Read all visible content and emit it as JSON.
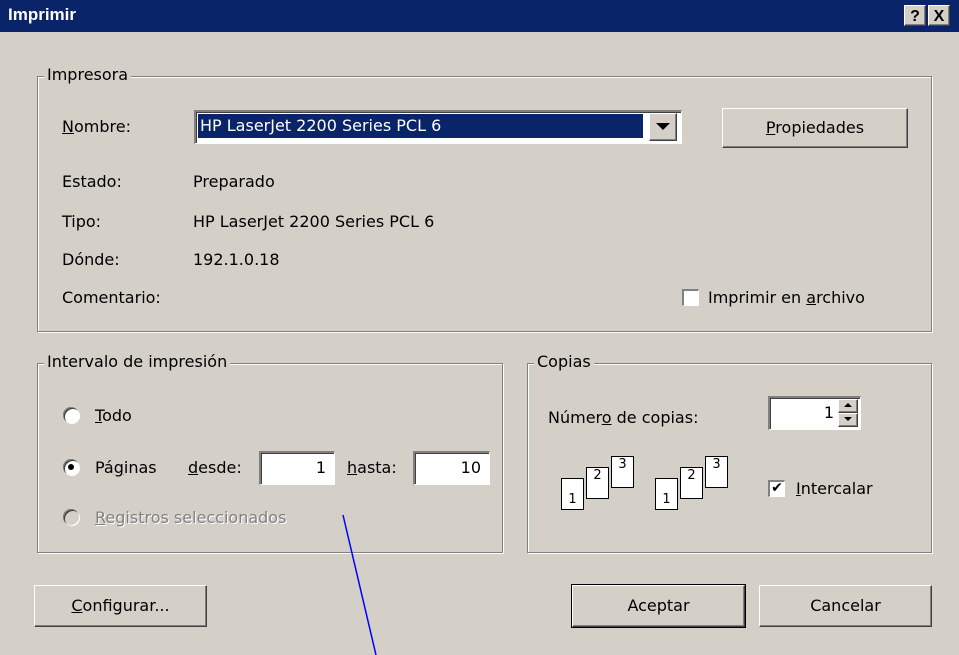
{
  "window": {
    "title": "Imprimir",
    "help_label": "?",
    "close_label": "X"
  },
  "printer_group": {
    "legend": "Impresora",
    "name_label_accel": "N",
    "name_label_rest": "ombre:",
    "name_value": "HP LaserJet 2200 Series PCL 6",
    "dropdown_icon": "chevron-down",
    "properties_accel": "P",
    "properties_rest": "ropiedades",
    "status_label": "Estado:",
    "status_value": "Preparado",
    "type_label": "Tipo:",
    "type_value": "HP LaserJet 2200 Series PCL 6",
    "where_label": "Dónde:",
    "where_value": "192.1.0.18",
    "comment_label": "Comentario:",
    "print_to_file_pre": "Imprimir en ",
    "print_to_file_accel": "a",
    "print_to_file_post": "rchivo",
    "print_to_file_checked": false
  },
  "range_group": {
    "legend": "Intervalo de impresión",
    "all_accel": "T",
    "all_rest": "odo",
    "pages_pre": "Pá",
    "pages_accel": "g",
    "pages_post": "inas",
    "from_accel": "d",
    "from_rest": "esde:",
    "from_value": "1",
    "to_accel": "h",
    "to_rest": "asta:",
    "to_value": "10",
    "selected_accel": "R",
    "selected_rest": "egistros seleccionados",
    "selected_option": "pages"
  },
  "copies_group": {
    "legend": "Copias",
    "count_pre": "Númer",
    "count_accel": "o",
    "count_post": " de copias:",
    "count_value": "1",
    "page_numbers": [
      "1",
      "2",
      "3"
    ],
    "collate_accel": "I",
    "collate_rest": "ntercalar",
    "collate_checked": true
  },
  "buttons": {
    "setup_accel": "C",
    "setup_rest": "onfigurar...",
    "ok_label": "Aceptar",
    "cancel_label": "Cancelar"
  },
  "colors": {
    "titlebar": "#0a246a",
    "face": "#d4d0c8",
    "selection": "#0a246a",
    "annotation_line": "#0000ff"
  }
}
